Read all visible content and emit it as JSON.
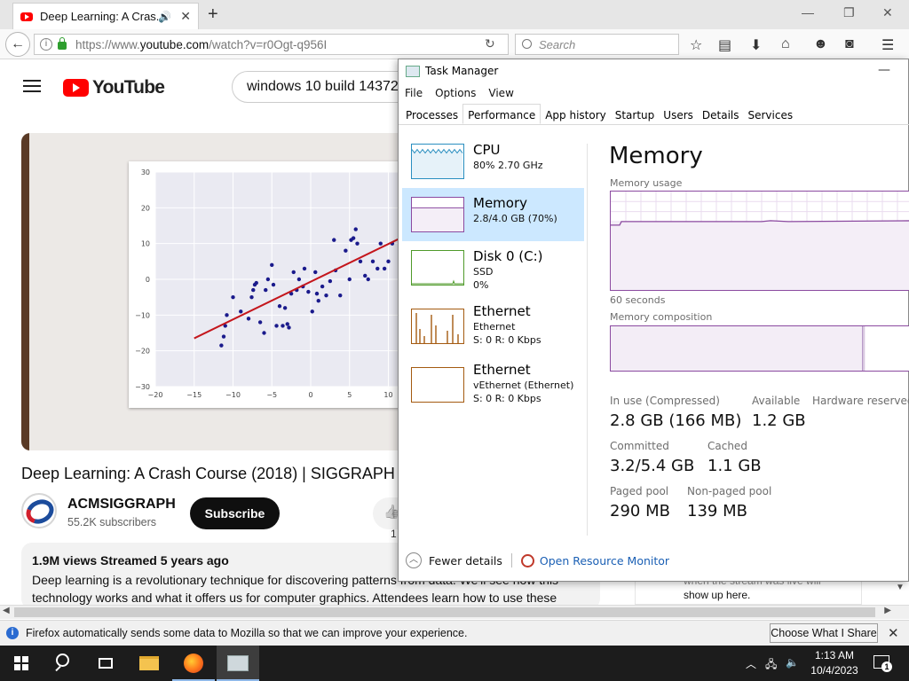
{
  "browser": {
    "tab_title": "Deep Learning: A Cras...",
    "url_prefix": "https://www.",
    "url_host": "youtube.com",
    "url_path": "/watch?v=r0Ogt-q956I",
    "search_placeholder": "Search"
  },
  "youtube": {
    "logo_text": "YouTube",
    "search_query": "windows 10 build 14372",
    "video_title": "Deep Learning: A Crash Course (2018) | SIGGRAPH",
    "channel_name": "ACMSIGGRAPH",
    "subscribers": "55.2K subscribers",
    "subscribe_label": "Subscribe",
    "like_count": "1",
    "views_meta": "1.9M views  Streamed 5 years ago",
    "desc_line1": "Deep learning is a revolutionary technique for discovering patterns from data. We'll see how this",
    "desc_line2": "technology works and what it offers us for computer graphics. Attendees learn how to use these",
    "chat_line1": "when the stream was live will",
    "chat_line2": "show up here."
  },
  "notification": {
    "message": "Firefox automatically sends some data to Mozilla so that we can improve your experience.",
    "button": "Choose What I Share"
  },
  "taskbar": {
    "time": "1:13 AM",
    "date": "10/4/2023",
    "notifications": "1"
  },
  "task_manager": {
    "title": "Task Manager",
    "menu": [
      "File",
      "Options",
      "View"
    ],
    "tabs": [
      "Processes",
      "Performance",
      "App history",
      "Startup",
      "Users",
      "Details",
      "Services"
    ],
    "active_tab": "Performance",
    "resources": [
      {
        "name": "CPU",
        "line1": "80%  2.70 GHz",
        "line2": "",
        "color": "#2a8fc0"
      },
      {
        "name": "Memory",
        "line1": "2.8/4.0 GB (70%)",
        "line2": "",
        "color": "#8b4aa0"
      },
      {
        "name": "Disk 0 (C:)",
        "line1": "SSD",
        "line2": "0%",
        "color": "#4f9a2a"
      },
      {
        "name": "Ethernet",
        "line1": "Ethernet",
        "line2": "S: 0  R: 0 Kbps",
        "color": "#a45a10"
      },
      {
        "name": "Ethernet",
        "line1": "vEthernet (Ethernet)",
        "line2": "S: 0  R: 0 Kbps",
        "color": "#a45a10"
      }
    ],
    "cpu_percent": 80,
    "selected_resource": "Memory",
    "memory": {
      "title": "Memory",
      "usage_label": "Memory usage",
      "graph_span": "60 seconds",
      "composition_label": "Memory composition",
      "in_use_label": "In use (Compressed)",
      "in_use": "2.8 GB (166 MB)",
      "available_label": "Available",
      "available": "1.2 GB",
      "hw_reserved_label": "Hardware reserved:",
      "committed_label": "Committed",
      "committed": "3.2/5.4 GB",
      "cached_label": "Cached",
      "cached": "1.1 GB",
      "paged_label": "Paged pool",
      "paged": "290 MB",
      "nonpaged_label": "Non-paged pool",
      "nonpaged": "139 MB",
      "usage_fraction": 0.7
    },
    "fewer_details": "Fewer details",
    "open_monitor": "Open Resource Monitor"
  },
  "chart_data": {
    "type": "scatter",
    "x_ticks": [
      "−20",
      "−15",
      "−10",
      "−5",
      "0",
      "5",
      "10"
    ],
    "y_ticks": [
      "30",
      "20",
      "10",
      "0",
      "−10",
      "−20",
      "−30"
    ],
    "xlim": [
      -20,
      12
    ],
    "ylim": [
      -30,
      30
    ],
    "grid": true,
    "points": [
      [
        -11.5,
        -18.5
      ],
      [
        -11.2,
        -16
      ],
      [
        -11,
        -13
      ],
      [
        -10.8,
        -10
      ],
      [
        -10,
        -5
      ],
      [
        -9,
        -9
      ],
      [
        -8,
        -11
      ],
      [
        -7.6,
        -5
      ],
      [
        -7.4,
        -3
      ],
      [
        -7.2,
        -1.5
      ],
      [
        -7,
        -1
      ],
      [
        -6.5,
        -12
      ],
      [
        -6,
        -15
      ],
      [
        -5.8,
        -3
      ],
      [
        -5.5,
        0
      ],
      [
        -5,
        4
      ],
      [
        -4.8,
        -1.5
      ],
      [
        -4.4,
        -13
      ],
      [
        -4,
        -7.5
      ],
      [
        -3.6,
        -13
      ],
      [
        -3.3,
        -8
      ],
      [
        -3,
        -12.5
      ],
      [
        -2.8,
        -13.5
      ],
      [
        -2.5,
        -4
      ],
      [
        -2.2,
        2
      ],
      [
        -1.8,
        -3
      ],
      [
        -1.5,
        0
      ],
      [
        -1,
        -2
      ],
      [
        -0.8,
        3
      ],
      [
        -0.3,
        -3.5
      ],
      [
        0.2,
        -9
      ],
      [
        0.6,
        2
      ],
      [
        0.8,
        -4
      ],
      [
        1,
        -6
      ],
      [
        1.5,
        -2
      ],
      [
        2,
        -4.5
      ],
      [
        2.5,
        -0.5
      ],
      [
        3,
        11
      ],
      [
        3.2,
        2.5
      ],
      [
        3.8,
        -4.5
      ],
      [
        4.5,
        8
      ],
      [
        5,
        0
      ],
      [
        5.2,
        11
      ],
      [
        5.5,
        11.5
      ],
      [
        5.8,
        14
      ],
      [
        6,
        10
      ],
      [
        6.4,
        5
      ],
      [
        7,
        1
      ],
      [
        7.4,
        0
      ],
      [
        8,
        5
      ],
      [
        8.6,
        3
      ],
      [
        9,
        10
      ],
      [
        9.5,
        3
      ],
      [
        10,
        5
      ],
      [
        10.5,
        10
      ]
    ],
    "fit_line": [
      [
        -15,
        -16.5
      ],
      [
        12,
        12
      ]
    ]
  }
}
